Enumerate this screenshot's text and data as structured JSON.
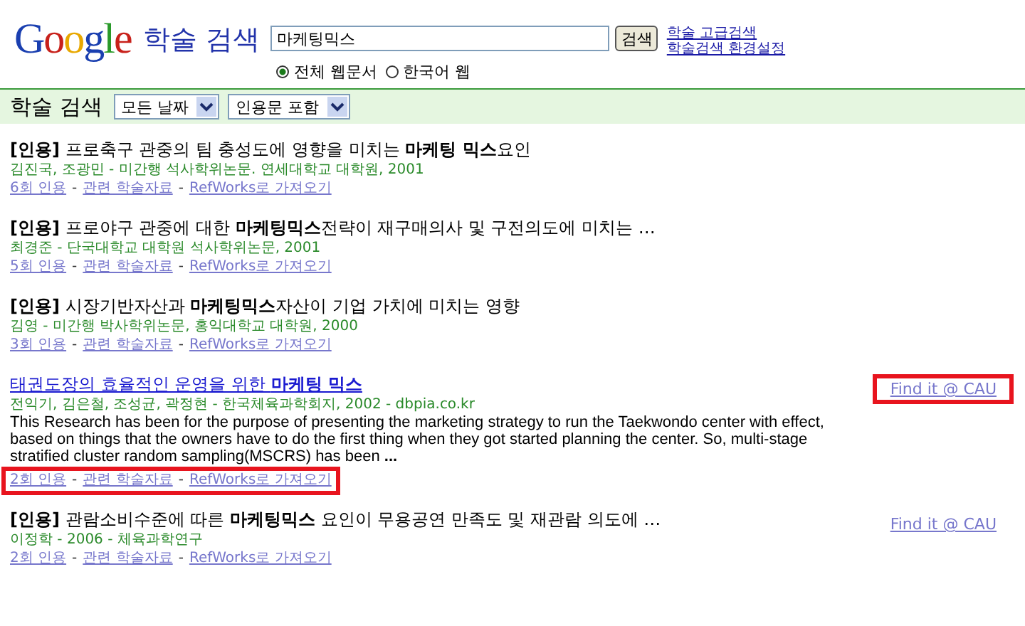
{
  "header": {
    "logo": "Google",
    "product": "학술 검색",
    "query": "마케팅믹스",
    "search_button": "검색",
    "links": [
      "학술 고급검색",
      "학술검색 환경설정"
    ],
    "scope": [
      {
        "label": "전체 웹문서",
        "selected": true
      },
      {
        "label": "한국어 웹",
        "selected": false
      }
    ]
  },
  "toolbar": {
    "title": "학술 검색",
    "filters": [
      "모든 날짜",
      "인용문 포함"
    ]
  },
  "results": [
    {
      "kind": "citation",
      "tag": "[인용]",
      "title": "프로축구 관중의 팀 충성도에 영향을 미치는 **마케팅 믹스**요인",
      "meta": "김진국,   조광민 - 미간행 석사학위논문. 연세대학교 대학원, 2001",
      "separators": [
        "-",
        "-"
      ],
      "links": [
        "6회 인용",
        "관련 학술자료",
        "RefWorks로 가져오기"
      ],
      "highlighted": false
    },
    {
      "kind": "citation",
      "tag": "[인용]",
      "title": "프로야구 관중에 대한 **마케팅믹스**전략이 재구매의사 및 구전의도에 미치는 …",
      "meta": "최경준 - 단국대학교 대학원 석사학위논문, 2001",
      "separators": [
        "-",
        "-"
      ],
      "links": [
        "5회 인용",
        "관련 학술자료",
        "RefWorks로 가져오기"
      ],
      "highlighted": false
    },
    {
      "kind": "citation",
      "tag": "[인용]",
      "title": "시장기반자산과 **마케팅믹스**자산이 기업 가치에 미치는 영향",
      "meta": "김영 - 미간행 박사학위논문, 홍익대학교 대학원, 2000",
      "separators": [
        "-",
        "-"
      ],
      "links": [
        "3회 인용",
        "관련 학술자료",
        "RefWorks로 가져오기"
      ],
      "highlighted": false
    },
    {
      "kind": "article",
      "title": "태권도장의 효율적인 운영을 위한 **마케팅 믹스**",
      "meta": "전익기,   김은철,   조성균,   곽정현 - 한국체육과학회지, 2002 - dbpia.co.kr",
      "snippet": "This Research has been for the purpose of presenting the marketing strategy to run the Taekwondo center with effect, based on things that the owners have to do the first thing when they got started planning the center. So, multi-stage stratified cluster random sampling(MSCRS) has been **...**",
      "separators": [
        "-",
        "-"
      ],
      "links": [
        "2회 인용",
        "관련 학술자료",
        "RefWorks로 가져오기"
      ],
      "highlighted": true,
      "find_it": {
        "label": "Find it @ CAU",
        "highlighted": true
      }
    },
    {
      "kind": "citation",
      "tag": "[인용]",
      "title": "관람소비수준에 따른 **마케팅믹스** 요인이 무용공연 만족도 및 재관람 의도에 …",
      "meta": "이정학 - 2006 - 체육과학연구",
      "separators": [
        "-",
        "-"
      ],
      "links": [
        "2회 인용",
        "관련 학술자료",
        "RefWorks로 가져오기"
      ],
      "highlighted": false,
      "find_it": {
        "label": "Find it @ CAU",
        "highlighted": false
      }
    }
  ]
}
